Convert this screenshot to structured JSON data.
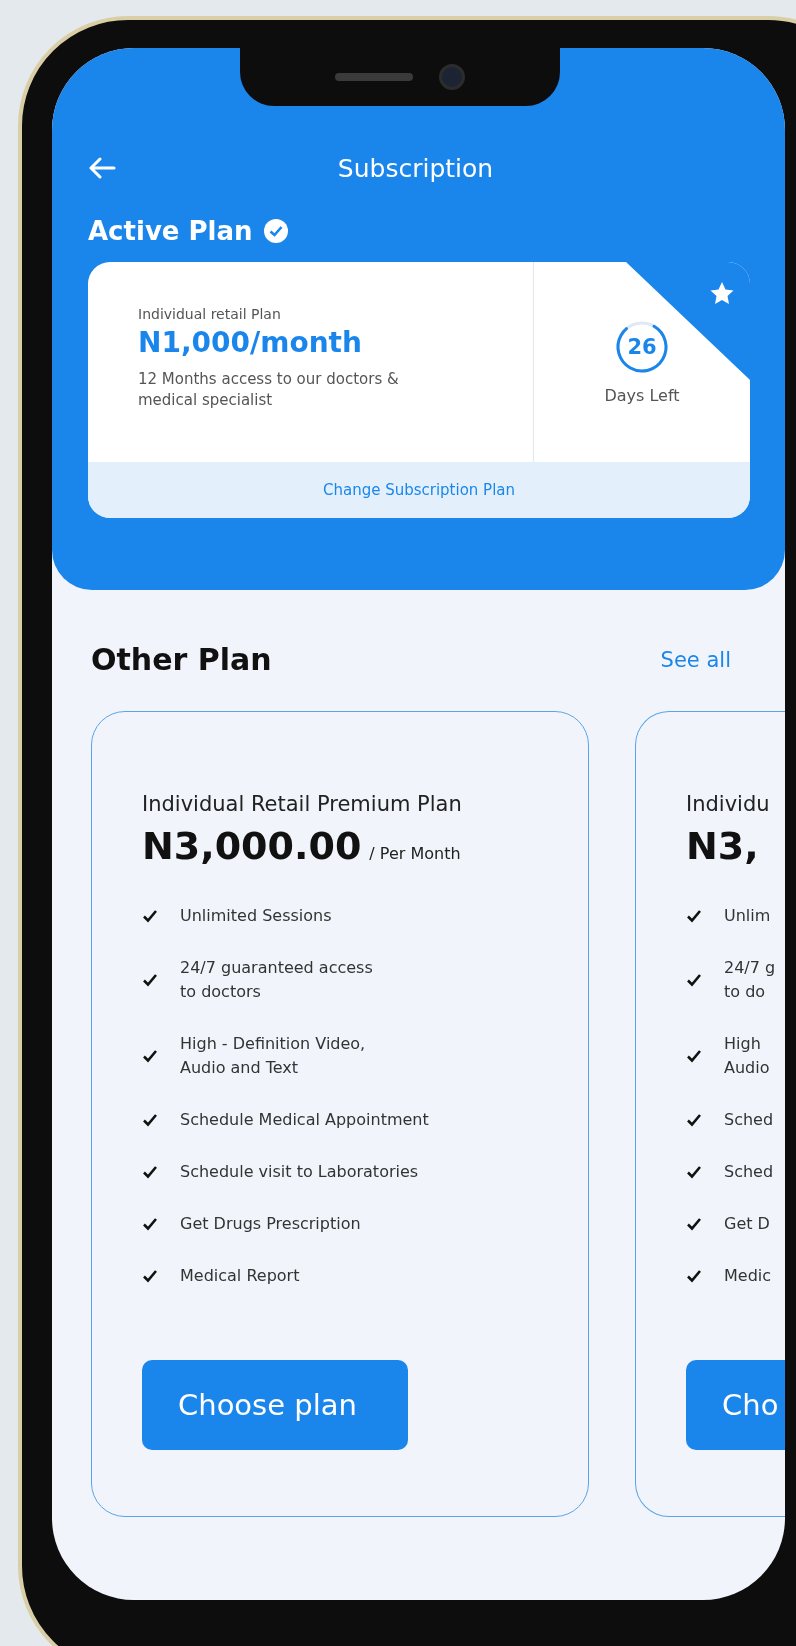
{
  "header": {
    "title": "Subscription"
  },
  "active_plan": {
    "heading": "Active Plan",
    "plan_name": "Individual retail Plan",
    "price": "N1,000/month",
    "description": "12 Months access to our doctors & medical specialist",
    "days": "26",
    "level": 0.8,
    "days_label": "Days Left",
    "change_link": "Change Subscription Plan"
  },
  "other_plans": {
    "heading": "Other Plan",
    "see_all": "See all",
    "plans": [
      {
        "name": "Individual Retail Premium Plan",
        "price": "N3,000.00",
        "period": "/ Per Month",
        "button": "Choose plan",
        "features": [
          {
            "lines": [
              "Unlimited  Sessions"
            ]
          },
          {
            "lines": [
              "24/7 guaranteed access",
              "to doctors"
            ]
          },
          {
            "lines": [
              "High - Definition Video,",
              "Audio and Text"
            ]
          },
          {
            "lines": [
              "Schedule Medical Appointment"
            ]
          },
          {
            "lines": [
              "Schedule visit to Laboratories"
            ]
          },
          {
            "lines": [
              "Get Drugs Prescription"
            ]
          },
          {
            "lines": [
              "Medical Report"
            ]
          }
        ]
      },
      {
        "name": "Individu",
        "price": "N3,",
        "button": "Cho",
        "features": [
          {
            "lines": [
              "Unlim"
            ]
          },
          {
            "lines": [
              "24/7 g",
              "to do"
            ]
          },
          {
            "lines": [
              "High",
              "Audio"
            ]
          },
          {
            "lines": [
              "Sched"
            ]
          },
          {
            "lines": [
              "Sched"
            ]
          },
          {
            "lines": [
              "Get D"
            ]
          },
          {
            "lines": [
              "Medic"
            ]
          }
        ]
      }
    ]
  }
}
